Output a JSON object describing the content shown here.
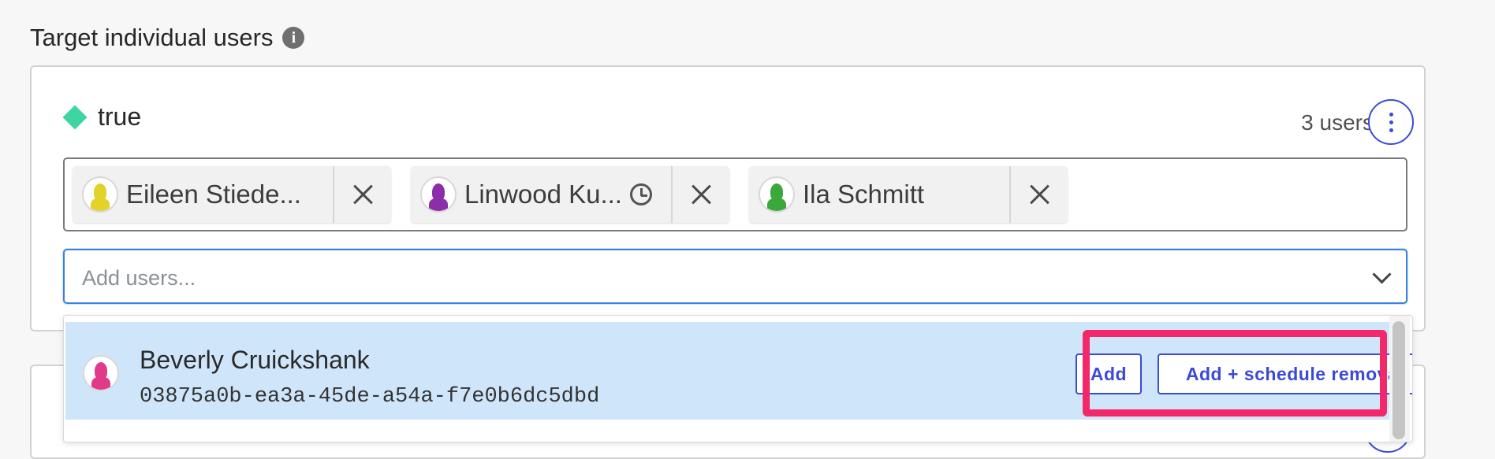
{
  "section": {
    "title": "Target individual users",
    "info_icon": "info-icon"
  },
  "variation": {
    "label": "true",
    "color": "#3dd6a3",
    "user_count": "3 users"
  },
  "chips": [
    {
      "name": "Eileen Stiede...",
      "avatar_color": "#e2d22a",
      "scheduled": false
    },
    {
      "name": "Linwood Ku...",
      "avatar_color": "#8a2fa8",
      "scheduled": true
    },
    {
      "name": "Ila Schmitt",
      "avatar_color": "#3aa83a",
      "scheduled": false
    }
  ],
  "add_input": {
    "placeholder": "Add users..."
  },
  "dropdown": {
    "option": {
      "name": "Beverly Cruickshank",
      "id": "03875a0b-ea3a-45de-a54a-f7e0b6dc5dbd",
      "avatar_color": "#e03a8a",
      "add_label": "Add",
      "schedule_label": "Add + schedule removal"
    }
  },
  "colors": {
    "accent": "#3b4ad6",
    "highlight": "#f2286a",
    "option_bg": "#cfe6fa"
  }
}
